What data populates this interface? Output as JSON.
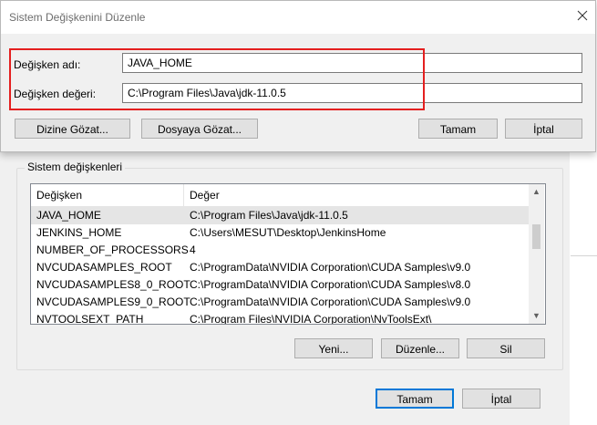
{
  "dialog": {
    "title": "Sistem Değişkenini Düzenle",
    "name_label": "Değişken adı:",
    "name_value": "JAVA_HOME",
    "value_label": "Değişken değeri:",
    "value_value": "C:\\Program Files\\Java\\jdk-11.0.5",
    "browse_dir_label": "Dizine Gözat...",
    "browse_file_label": "Dosyaya Gözat...",
    "ok_label": "Tamam",
    "cancel_label": "İptal"
  },
  "env_window": {
    "group_label": "Sistem değişkenleri",
    "columns": [
      "Değişken",
      "Değer"
    ],
    "rows": [
      {
        "name": "JAVA_HOME",
        "value": "C:\\Program Files\\Java\\jdk-11.0.5",
        "selected": true
      },
      {
        "name": "JENKINS_HOME",
        "value": "C:\\Users\\MESUT\\Desktop\\JenkinsHome"
      },
      {
        "name": "NUMBER_OF_PROCESSORS",
        "value": "4"
      },
      {
        "name": "NVCUDASAMPLES_ROOT",
        "value": "C:\\ProgramData\\NVIDIA Corporation\\CUDA Samples\\v9.0"
      },
      {
        "name": "NVCUDASAMPLES8_0_ROOT",
        "value": "C:\\ProgramData\\NVIDIA Corporation\\CUDA Samples\\v8.0"
      },
      {
        "name": "NVCUDASAMPLES9_0_ROOT",
        "value": "C:\\ProgramData\\NVIDIA Corporation\\CUDA Samples\\v9.0"
      },
      {
        "name": "NVTOOLSEXT_PATH",
        "value": "C:\\Program Files\\NVIDIA Corporation\\NvToolsExt\\"
      }
    ],
    "new_label": "Yeni...",
    "edit_label": "Düzenle...",
    "delete_label": "Sil",
    "ok_label": "Tamam",
    "cancel_label": "İptal"
  },
  "colors": {
    "highlight_box": "#e41f1f",
    "default_button_border": "#0078d7",
    "selected_row": "#e5e5e5"
  }
}
